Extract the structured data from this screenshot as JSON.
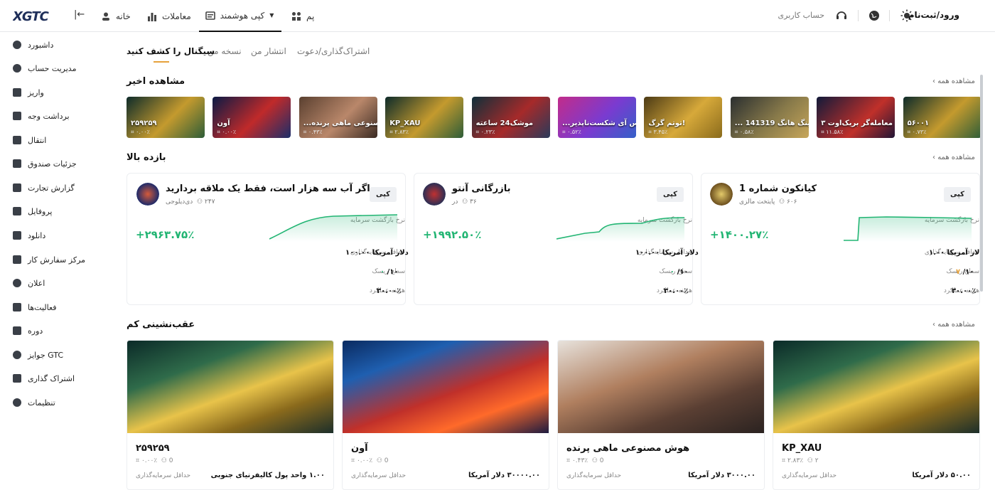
{
  "header": {
    "logo": "XGTC",
    "nav": [
      "خانه",
      "معاملات",
      "کپی هوشمند",
      "پم"
    ],
    "search_placeholder": "حساب کاربری",
    "login": "ورود/ثبت‌نام"
  },
  "sidebar": {
    "items": [
      "داشبورد",
      "مدیریت حساب",
      "واریز",
      "برداشت وجه",
      "انتقال",
      "جزئیات صندوق",
      "گزارش تجارت",
      "پروفایل",
      "دانلود",
      "مرکز سفارش کار",
      "اعلان",
      "فعالیت‌ها",
      "دوره",
      "جوایز GTC",
      "اشتراک گذاری",
      "تنظیمات"
    ]
  },
  "tabs": [
    "اشتراک‌گذاری/دعوت",
    "انتشار من",
    "نسخه من",
    "سیگنال را کشف کنید"
  ],
  "recent": {
    "title": "مشاهده اخیر",
    "see_all": "مشاهده همه",
    "cards": [
      {
        "title": "۵۶۰۰۱",
        "sub": "۰.۷۳٪"
      },
      {
        "title": "معامله‌گر بریک‌اوت ۳",
        "sub": "۱۱.۵۸٪"
      },
      {
        "title": "... دینگ هانگ 141319",
        "sub": "۰.۵۸٪"
      },
      {
        "title": "توتم گرگ!",
        "sub": "۳.۴۵٪"
      },
      {
        "title": "...لس آی شکست‌ناپذیر",
        "sub": "۰.۵۲٪"
      },
      {
        "title": "موشک24 ساعته",
        "sub": "۰.۲۳٪"
      },
      {
        "title": "KP_XAU",
        "sub": "۲.۸۳٪"
      },
      {
        "title": "...صنوعی ماهی پرنده",
        "sub": "۰.۴۳٪"
      },
      {
        "title": "آون",
        "sub": "۰.۰۰٪"
      },
      {
        "title": "۲۵۹۲۵۹",
        "sub": "۰.۰۰٪"
      }
    ]
  },
  "top_returns": {
    "title": "بازده بالا",
    "see_all": "مشاهده همه",
    "copy_label": "کپی",
    "roi_label": "نرخ بازگشت سرمایه",
    "min_label": "حداقل سرمایه‌گذاری",
    "risk_label": "سطح ریسک",
    "fee_label": "هزینه عملکرد",
    "cards": [
      {
        "name": "کیانکون شماره 1",
        "followers": "۶۰۶",
        "owner": "پایتخت مالزی",
        "roi": "+۱۴۰۰.۲۷٪",
        "min": "۱.۰۰ دلار آمریکا",
        "risk": "۷",
        "risk_of": "/۱۰",
        "fee": "۳۰.۰۰٪"
      },
      {
        "name": "بازرگانی آنتو",
        "followers": "۳۶",
        "owner": "در",
        "roi": "+۱۹۹۲.۵۰٪",
        "min": "۱۰۰.۰۰ دلار آمریکا",
        "risk": "۰",
        "risk_of": "/۱۰",
        "fee": "۳۰.۰۰٪"
      },
      {
        "name": "اگر آب سه هزار است، فقط یک ملاقه بردارید",
        "followers": "۲۴۷",
        "owner": "دی‌دیلوجی",
        "roi": "+۲۹۶۳.۷۵٪",
        "min": "۱۰۰.۰۰ دلار آمریکا",
        "risk": "۰",
        "risk_of": "/۱۰",
        "fee": "۳۰.۰۰٪"
      }
    ]
  },
  "low_drawdown": {
    "title": "عقب‌نشینی کم",
    "see_all": "مشاهده همه",
    "min_label": "حداقل سرمایه‌گذاری",
    "cards": [
      {
        "name": "KP_XAU",
        "pct": "۲.۸۳٪",
        "followers": "۲",
        "min": "۵۰.۰۰ دلار آمریکا"
      },
      {
        "name": "هوش مصنوعی ماهی پرنده",
        "pct": "۰.۴۳٪",
        "followers": "0",
        "min": "۳۰۰۰.۰۰ دلار آمریکا"
      },
      {
        "name": "آون",
        "pct": "۰.۰۰٪",
        "followers": "0",
        "min": "۳۰۰۰۰.۰۰ دلار آمریکا"
      },
      {
        "name": "۲۵۹۲۵۹",
        "pct": "۰.۰۰٪",
        "followers": "0",
        "min": "۱.۰۰ واحد پول کالیفرنیای جنوبی"
      }
    ]
  }
}
